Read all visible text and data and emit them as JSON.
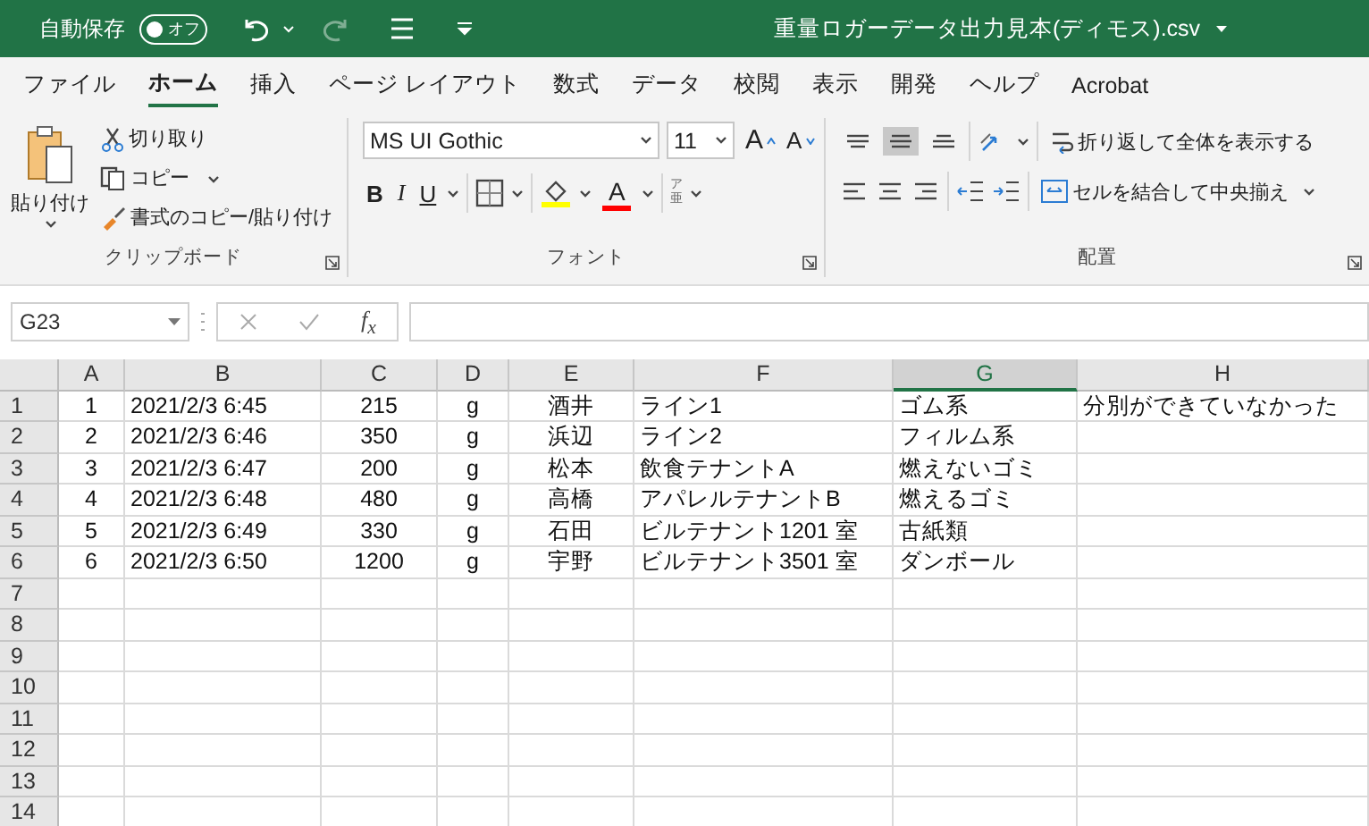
{
  "title_bar": {
    "autosave_label": "自動保存",
    "autosave": {
      "on": false,
      "label": "オフ"
    },
    "filename": "重量ロガーデータ出力見本(ディモス).csv"
  },
  "tabs": [
    {
      "label": "ファイル",
      "selected": false
    },
    {
      "label": "ホーム",
      "selected": true
    },
    {
      "label": "挿入",
      "selected": false
    },
    {
      "label": "ページ レイアウト",
      "selected": false
    },
    {
      "label": "数式",
      "selected": false
    },
    {
      "label": "データ",
      "selected": false
    },
    {
      "label": "校閲",
      "selected": false
    },
    {
      "label": "表示",
      "selected": false
    },
    {
      "label": "開発",
      "selected": false
    },
    {
      "label": "ヘルプ",
      "selected": false
    },
    {
      "label": "Acrobat",
      "selected": false
    }
  ],
  "ribbon": {
    "clipboard": {
      "paste": "貼り付け",
      "cut": "切り取り",
      "copy": "コピー",
      "format_painter": "書式のコピー/貼り付け",
      "label": "クリップボード"
    },
    "font": {
      "font_name": "MS UI Gothic",
      "font_size": "11",
      "grow": "A",
      "shrink": "A",
      "bold": "B",
      "italic": "I",
      "underline": "U",
      "font_color": "A",
      "phonetic": [
        "ア",
        "亜"
      ],
      "label": "フォント"
    },
    "alignment": {
      "vertical": [
        {
          "kind": "top",
          "selected": false
        },
        {
          "kind": "middle",
          "selected": true
        },
        {
          "kind": "bottom",
          "selected": false
        }
      ],
      "wrap_text": "折り返して全体を表示する",
      "merge": "セルを結合して中央揃え",
      "label": "配置"
    }
  },
  "formula_bar": {
    "name_box": "G23",
    "fx": "f$_{x}$"
  },
  "sheet": {
    "columns": [
      {
        "label": "A",
        "selected": false
      },
      {
        "label": "B",
        "selected": false
      },
      {
        "label": "C",
        "selected": false
      },
      {
        "label": "D",
        "selected": false
      },
      {
        "label": "E",
        "selected": false
      },
      {
        "label": "F",
        "selected": false
      },
      {
        "label": "G",
        "selected": true
      },
      {
        "label": "H",
        "selected": false
      }
    ],
    "rows": [
      {
        "number": "1",
        "cells": [
          "1",
          "2021/2/3 6:45",
          "215",
          "g",
          "酒井",
          "ライン1",
          "ゴム系",
          "分別ができていなかった"
        ]
      },
      {
        "number": "2",
        "cells": [
          "2",
          "2021/2/3 6:46",
          "350",
          "g",
          "浜辺",
          "ライン2",
          "フィルム系"
        ]
      },
      {
        "number": "3",
        "cells": [
          "3",
          "2021/2/3 6:47",
          "200",
          "g",
          "松本",
          "飲食テナントA",
          "燃えないゴミ"
        ]
      },
      {
        "number": "4",
        "cells": [
          "4",
          "2021/2/3 6:48",
          "480",
          "g",
          "高橋",
          "アパレルテナントB",
          "燃えるゴミ"
        ]
      },
      {
        "number": "5",
        "cells": [
          "5",
          "2021/2/3 6:49",
          "330",
          "g",
          "石田",
          "ビルテナント1201 室",
          "古紙類"
        ]
      },
      {
        "number": "6",
        "cells": [
          "6",
          "2021/2/3 6:50",
          "1200",
          "g",
          "宇野",
          "ビルテナント3501 室",
          "ダンボール"
        ]
      },
      {
        "number": "7"
      },
      {
        "number": "8"
      },
      {
        "number": "9"
      },
      {
        "number": "10"
      },
      {
        "number": "11"
      },
      {
        "number": "12"
      },
      {
        "number": "13"
      },
      {
        "number": "14"
      }
    ]
  }
}
